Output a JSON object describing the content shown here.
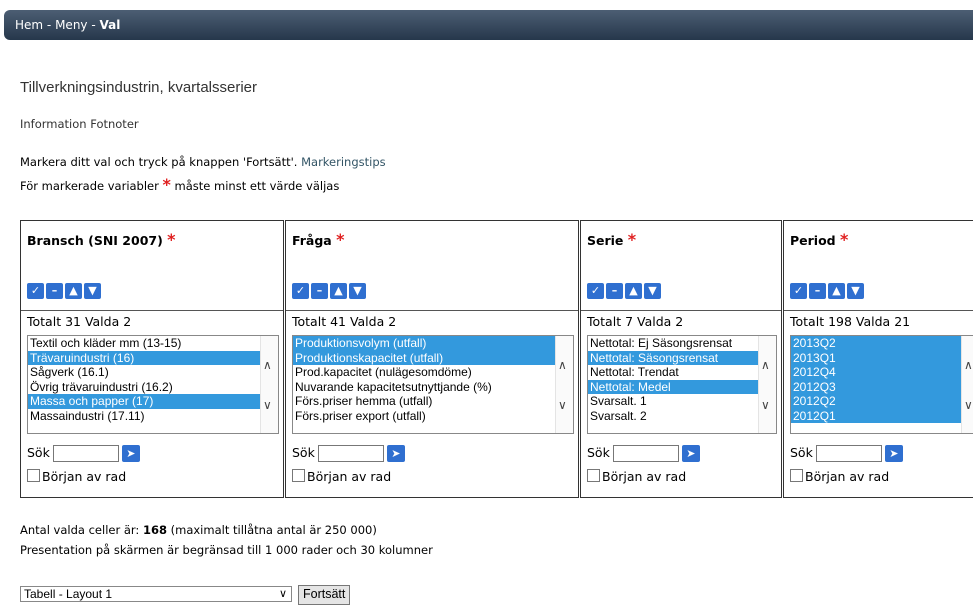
{
  "breadcrumb": {
    "home": "Hem",
    "sep1": " - ",
    "menu": "Meny",
    "sep2": " - ",
    "current": "Val"
  },
  "page_title": "Tillverkningsindustrin, kvartalsserier",
  "links": {
    "information": "Information",
    "footnotes": "Fotnoter"
  },
  "instructions": {
    "line1_text": "Markera ditt val och tryck på knappen 'Fortsätt'. ",
    "line1_link": "Markeringstips",
    "line2_a": "För markerade variabler ",
    "line2_star": "*",
    "line2_b": " måste minst ett värde väljas"
  },
  "panels": [
    {
      "title": "Bransch (SNI 2007)",
      "star": "*",
      "total_label": "Totalt 31 Valda ",
      "total_count": "2",
      "items": [
        {
          "label": "Textil och kläder mm (13-15)",
          "selected": false
        },
        {
          "label": "Trävaruindustri (16)",
          "selected": true
        },
        {
          "label": "Sågverk (16.1)",
          "selected": false
        },
        {
          "label": "Övrig trävaruindustri (16.2)",
          "selected": false
        },
        {
          "label": "Massa och papper (17)",
          "selected": true
        },
        {
          "label": "Massaindustri (17.11)",
          "selected": false
        }
      ],
      "search_label": "Sök",
      "checkbox_label": "Början av rad"
    },
    {
      "title": "Fråga",
      "star": "*",
      "total_label": "Totalt 41 Valda ",
      "total_count": "2",
      "items": [
        {
          "label": "Produktionsvolym (utfall)",
          "selected": true
        },
        {
          "label": "Produktionskapacitet (utfall)",
          "selected": true
        },
        {
          "label": "Prod.kapacitet (nulägesomdöme)",
          "selected": false
        },
        {
          "label": "Nuvarande kapacitetsutnyttjande (%)",
          "selected": false
        },
        {
          "label": "Förs.priser hemma (utfall)",
          "selected": false
        },
        {
          "label": "Förs.priser export (utfall)",
          "selected": false
        }
      ],
      "search_label": "Sök",
      "checkbox_label": "Början av rad"
    },
    {
      "title": "Serie",
      "star": "*",
      "total_label": "Totalt 7 Valda ",
      "total_count": "2",
      "items": [
        {
          "label": "Nettotal: Ej Säsongsrensat",
          "selected": false
        },
        {
          "label": "Nettotal: Säsongsrensat",
          "selected": true
        },
        {
          "label": "Nettotal: Trendat",
          "selected": false
        },
        {
          "label": "Nettotal: Medel",
          "selected": true
        },
        {
          "label": "Svarsalt. 1",
          "selected": false
        },
        {
          "label": "Svarsalt. 2",
          "selected": false
        }
      ],
      "search_label": "Sök",
      "checkbox_label": "Början av rad"
    },
    {
      "title": "Period",
      "star": "*",
      "total_label": "Totalt 198 Valda ",
      "total_count": "21",
      "items": [
        {
          "label": "2013Q2",
          "selected": true
        },
        {
          "label": "2013Q1",
          "selected": true
        },
        {
          "label": "2012Q4",
          "selected": true
        },
        {
          "label": "2012Q3",
          "selected": true
        },
        {
          "label": "2012Q2",
          "selected": true
        },
        {
          "label": "2012Q1",
          "selected": true
        }
      ],
      "search_label": "Sök",
      "checkbox_label": "Början av rad"
    }
  ],
  "summary": {
    "cells_a": "Antal valda celler är: ",
    "cells_count": "168",
    "cells_b": " (maximalt tillåtna antal är 250 000)",
    "limit": "Presentation på skärmen är begränsad till 1 000 rader och 30 kolumner"
  },
  "layout_select": {
    "value": "Tabell - Layout 1"
  },
  "continue_button": "Fortsätt",
  "colors": {
    "selected_bg": "#3399dd",
    "header_bar": "#26374b",
    "required_star": "#e02020",
    "icon_button": "#2f6fd0"
  },
  "icons": [
    "select-all-icon",
    "deselect-all-icon",
    "move-up-icon",
    "move-down-icon",
    "search-go-icon"
  ]
}
